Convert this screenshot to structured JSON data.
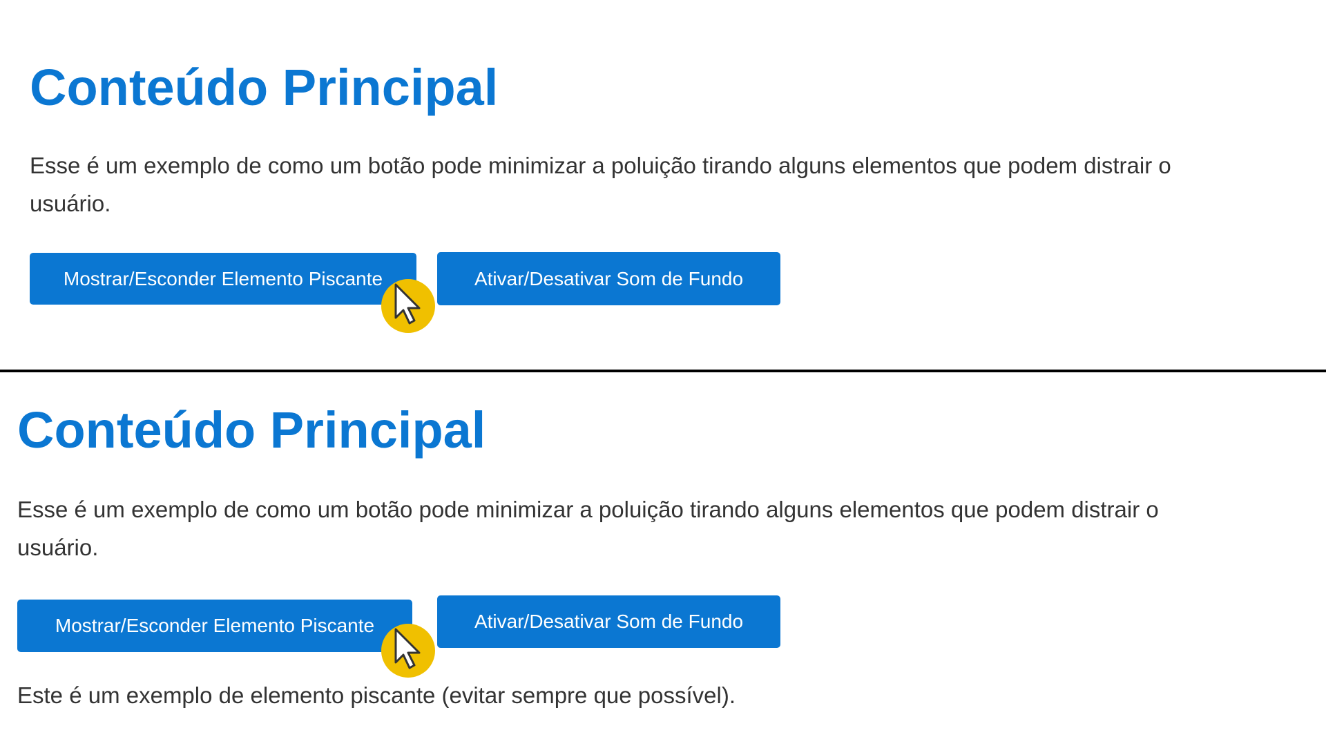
{
  "colors": {
    "accent": "#0b77d2",
    "text": "#333333",
    "background": "#ffffff",
    "divider": "#000000",
    "cursor_highlight": "#f0c000"
  },
  "before": {
    "title": "Conteúdo Principal",
    "description": "Esse é um exemplo de como um botão pode minimizar a poluição tirando alguns elementos que podem distrair o usuário.",
    "toggle_blink_label": "Mostrar/Esconder Elemento Piscante",
    "toggle_sound_label": "Ativar/Desativar Som de Fundo",
    "cursor_icon": "mouse-pointer-icon"
  },
  "after": {
    "title": "Conteúdo Principal",
    "description": "Esse é um exemplo de como um botão pode minimizar a poluição tirando alguns elementos que podem distrair o usuário.",
    "toggle_blink_label": "Mostrar/Esconder Elemento Piscante",
    "toggle_sound_label": "Ativar/Desativar Som de Fundo",
    "blinking_note": "Este é um exemplo de elemento piscante (evitar sempre que possível).",
    "cursor_icon": "mouse-pointer-icon"
  }
}
